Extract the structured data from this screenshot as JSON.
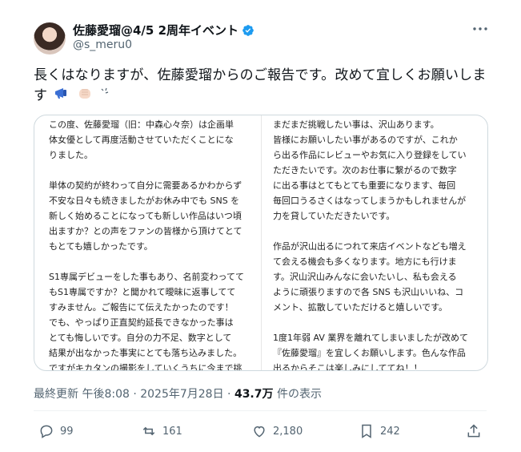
{
  "author": {
    "name": "佐藤愛瑠@4/5 2周年イベント",
    "handle": "@s_meru0"
  },
  "post": {
    "text_line1": "長くはなりますが、佐藤愛瑠からのご報告です。改めて宜しくお願いしま",
    "text_line2": "す",
    "emoji": [
      "megaphone",
      "fist",
      "sparkle"
    ]
  },
  "image": {
    "left_column": "この度、佐藤愛瑠（旧：中森心々奈）は企画単\n体女優として再度活動させていただくことにな\nりました。\n\n単体の契約が終わって自分に需要あるかわからず\n不安な日々も続きましたがお休み中でも SNS を\n新しく始めることになっても新しい作品はいつ頃\n出ますか？との声をファンの皆様から頂けてとて\nもとても嬉しかったです。\n\nS1専属デビューをした事もあり、名前変わってて\nもS1専属ですか？と聞かれて曖昧に返事してて\nすみません。ご報告にて伝えたかったのです！\nでも、やっぱり正直契約延長できなかった事は\nとても悔しいです。自分の力不足、数字として\n結果が出なかった事実にとても落ち込みました。\nですがキカタンの撮影をしていくうちに今まで挑\n戦してこなかった事をさせていただく機会が増え",
    "right_column": "まだまだ挑戦したい事は、沢山あります。\n皆様にお願いしたい事があるのですが、これか\nら出る作品にレビューやお気に入り登録をしてい\nただきたいです。次のお仕事に繋がるので数字\nに出る事はとてもとても重要になります、毎回\n毎回口うるさくはなってしまうかもしれませんが\n力を貸していただきたいです。\n\n作品が沢山出るにつれて来店イベントなども増え\nて会える機会も多くなります。地方にも行けま\nす。沢山沢山みんなに会いたいし、私も会える\nように頑張りますので各 SNS も沢山いいね、コ\nメント、拡散していただけると嬉しいです。\n\n1度1年弱 AV 業界を離れてしまいましたが改めて\n『佐藤愛瑠』を宜しくお願いします。色んな作品\n出るからそこは楽しみにしててね！！"
  },
  "meta": {
    "updated": "最終更新 午後8:08 · 2025年7月28日 · ",
    "views": "43.7万",
    "views_suffix": " 件の表示"
  },
  "actions": {
    "replies": "99",
    "reposts": "161",
    "likes": "2,180",
    "bookmarks": "242"
  },
  "colors": {
    "verified": "#1d9bf0",
    "muted": "#536471"
  }
}
